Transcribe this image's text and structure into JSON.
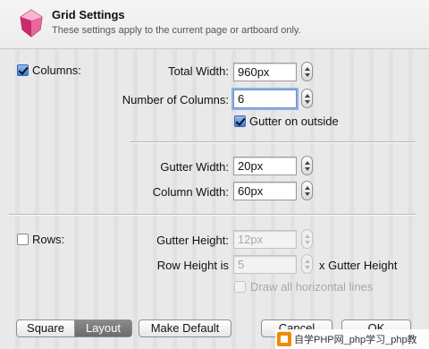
{
  "header": {
    "title": "Grid Settings",
    "subtitle": "These settings apply to the current page or artboard only."
  },
  "columns": {
    "enabled_label": "Columns:",
    "enabled": true,
    "total_width_label": "Total Width:",
    "total_width_value": "960px",
    "number_label": "Number of Columns:",
    "number_value": "6",
    "gutter_outside_label": "Gutter on outside",
    "gutter_outside_checked": true,
    "gutter_width_label": "Gutter Width:",
    "gutter_width_value": "20px",
    "column_width_label": "Column Width:",
    "column_width_value": "60px"
  },
  "rows": {
    "enabled_label": "Rows:",
    "enabled": false,
    "gutter_height_label": "Gutter Height:",
    "gutter_height_value": "12px",
    "row_height_label": "Row Height is",
    "row_height_value": "5",
    "row_height_suffix": "x Gutter Height",
    "draw_lines_label": "Draw all horizontal lines",
    "draw_lines_checked": false
  },
  "footer": {
    "square_label": "Square",
    "layout_label": "Layout",
    "make_default_label": "Make Default",
    "cancel_label": "Cancel",
    "ok_label": "OK",
    "watermark": "自学PHP网_php学习_php教"
  },
  "colors": {
    "accent": "#3a7bd9",
    "gem": "#d63a7a"
  }
}
